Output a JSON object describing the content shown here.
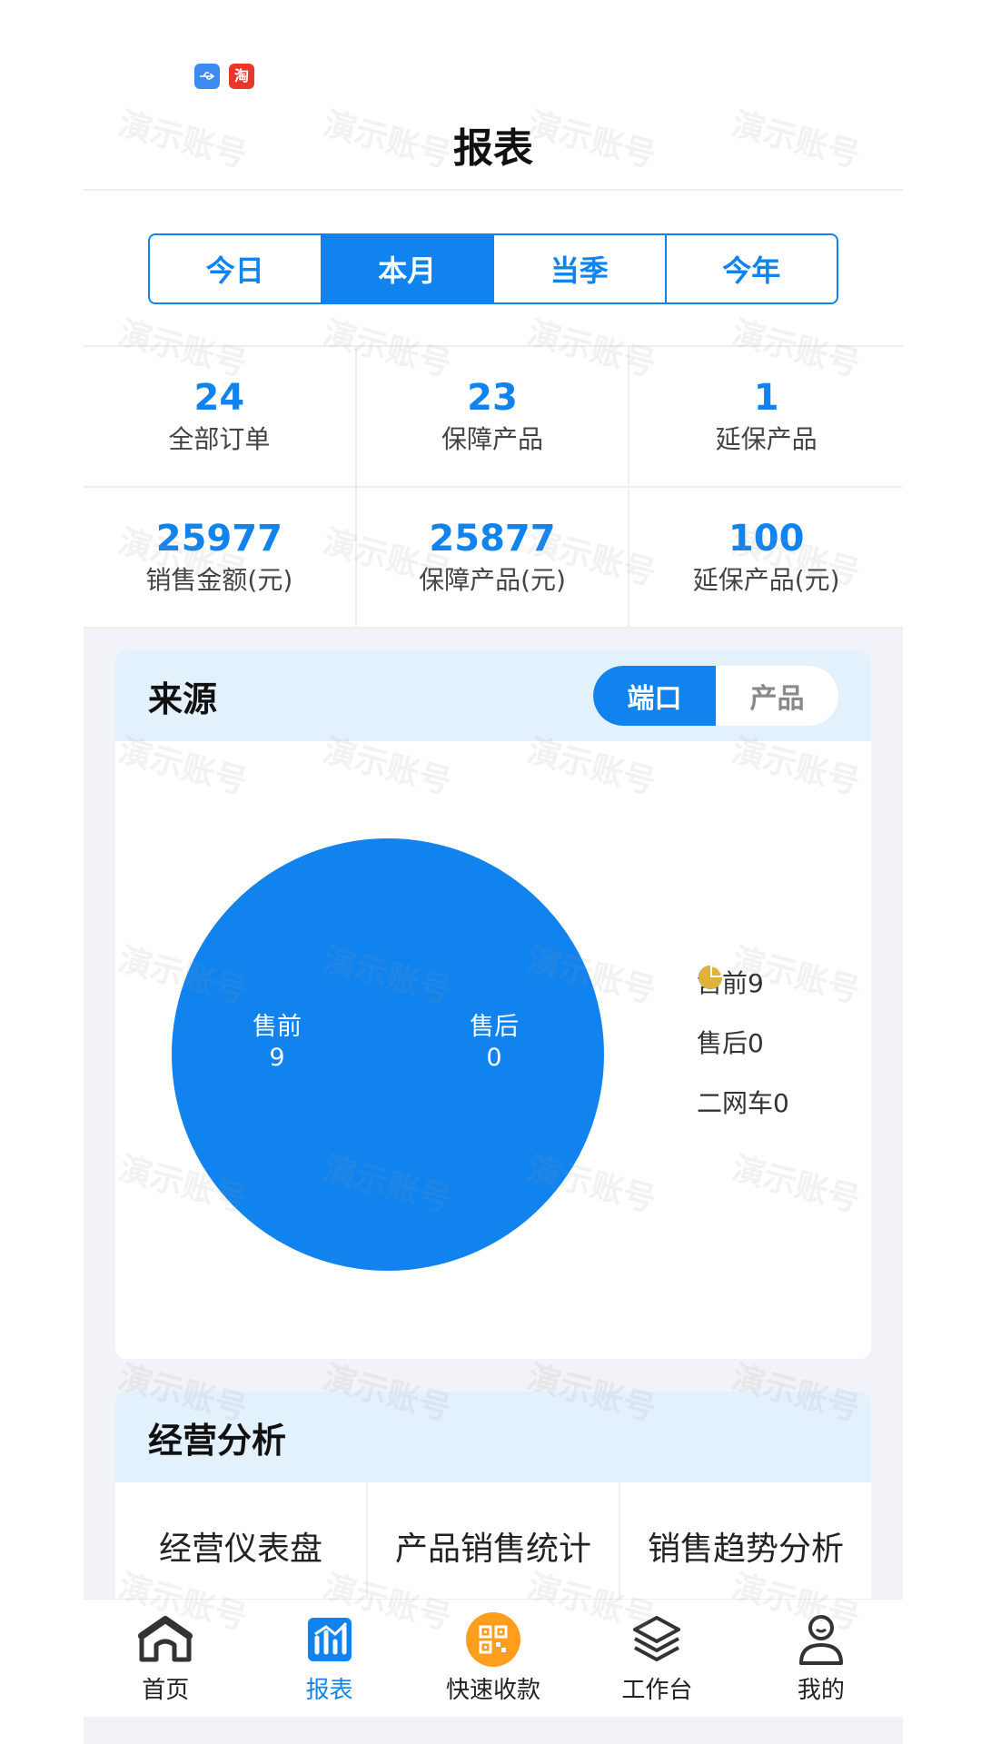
{
  "header": {
    "title": "报表"
  },
  "periods": [
    {
      "label": "今日",
      "active": false
    },
    {
      "label": "本月",
      "active": true
    },
    {
      "label": "当季",
      "active": false
    },
    {
      "label": "今年",
      "active": false
    }
  ],
  "stats": [
    {
      "value": "24",
      "label": "全部订单"
    },
    {
      "value": "23",
      "label": "保障产品"
    },
    {
      "value": "1",
      "label": "延保产品"
    },
    {
      "value": "25977",
      "label": "销售金额(元)"
    },
    {
      "value": "25877",
      "label": "保障产品(元)"
    },
    {
      "value": "100",
      "label": "延保产品(元)"
    }
  ],
  "source": {
    "title": "来源",
    "toggle": [
      {
        "label": "端口",
        "active": true
      },
      {
        "label": "产品",
        "active": false
      }
    ],
    "legend": [
      {
        "label": "售前9",
        "color": "#1083ef"
      },
      {
        "label": "售后0",
        "color": "#13b26b"
      },
      {
        "label": "二网车0",
        "color": "#e1b23a"
      }
    ]
  },
  "chart_data": {
    "type": "pie",
    "categories": [
      "售前",
      "售后",
      "二网车"
    ],
    "values": [
      9,
      0,
      0
    ],
    "slice_labels": [
      {
        "name": "售前",
        "value": "9"
      },
      {
        "name": "售后",
        "value": "0"
      }
    ],
    "colors": [
      "#1083ef",
      "#13b26b",
      "#e1b23a"
    ]
  },
  "analysis": {
    "title": "经营分析",
    "links": [
      "经营仪表盘",
      "产品销售统计",
      "销售趋势分析"
    ]
  },
  "nav": [
    {
      "label": "首页",
      "icon": "home-icon",
      "active": false
    },
    {
      "label": "报表",
      "icon": "report-icon",
      "active": true
    },
    {
      "label": "快速收款",
      "icon": "qr-code-icon",
      "active": false
    },
    {
      "label": "工作台",
      "icon": "layers-icon",
      "active": false
    },
    {
      "label": "我的",
      "icon": "user-icon",
      "active": false
    }
  ],
  "watermark": "演示账号",
  "status_icons": {
    "taobao_glyph": "淘"
  }
}
